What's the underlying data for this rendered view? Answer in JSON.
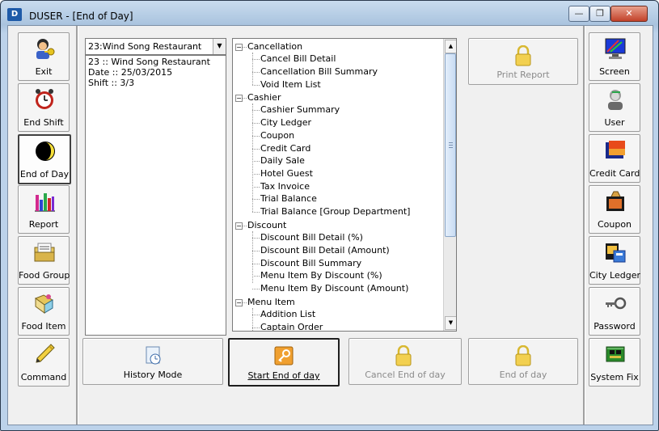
{
  "window": {
    "title": "DUSER - [End of Day]",
    "app_icon": "D"
  },
  "controls": {
    "minimize": "—",
    "restore": "❐",
    "close": "✕"
  },
  "left_sidebar": [
    {
      "label": "Exit",
      "icon": "user-key-icon"
    },
    {
      "label": "End Shift",
      "icon": "alarm-clock-icon"
    },
    {
      "label": "End of Day",
      "icon": "moon-icon",
      "active": true
    },
    {
      "label": "Report",
      "icon": "bar-chart-icon"
    },
    {
      "label": "Food Group",
      "icon": "folder-icon"
    },
    {
      "label": "Food Item",
      "icon": "food-item-icon"
    },
    {
      "label": "Command",
      "icon": "pencil-icon"
    }
  ],
  "right_sidebar": [
    {
      "label": "Screen",
      "icon": "monitor-icon"
    },
    {
      "label": "User",
      "icon": "user-icon"
    },
    {
      "label": "Credit Card",
      "icon": "credit-card-icon"
    },
    {
      "label": "Coupon",
      "icon": "coupon-icon"
    },
    {
      "label": "City Ledger",
      "icon": "city-ledger-icon"
    },
    {
      "label": "Password",
      "icon": "key-icon"
    },
    {
      "label": "System Fix",
      "icon": "circuit-board-icon"
    }
  ],
  "outlet_select": {
    "value": "23:Wind Song Restaurant"
  },
  "info": {
    "line1": "23 :: Wind Song Restaurant",
    "line2": "Date :: 25/03/2015",
    "line3": "Shift :: 3/3"
  },
  "report_tree": [
    {
      "label": "Cancellation",
      "children": [
        "Cancel Bill Detail",
        "Cancellation Bill Summary",
        "Void Item List"
      ]
    },
    {
      "label": "Cashier",
      "children": [
        "Cashier Summary",
        "City Ledger",
        "Coupon",
        "Credit Card",
        "Daily Sale",
        "Hotel Guest",
        "Tax Invoice",
        "Trial Balance",
        "Trial Balance [Group Department]"
      ]
    },
    {
      "label": "Discount",
      "children": [
        "Discount Bill Detail (%)",
        "Discount Bill Detail (Amount)",
        "Discount Bill Summary",
        "Menu Item By Discount (%)",
        "Menu Item By Discount (Amount)"
      ]
    },
    {
      "label": "Menu Item",
      "children": [
        "Addition List",
        "Captain Order"
      ]
    }
  ],
  "buttons": {
    "print_report": "Print Report",
    "history_mode": "History Mode",
    "start_end_of_day": "Start End of day",
    "cancel_end_of_day": "Cancel End of day",
    "end_of_day": "End of day"
  }
}
